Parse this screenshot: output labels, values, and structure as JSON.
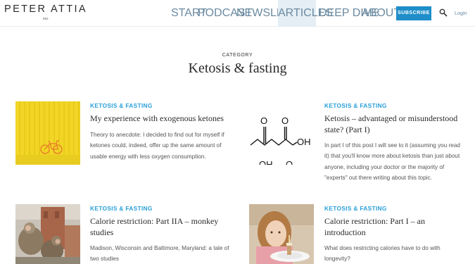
{
  "header": {
    "logo": "PETER ATTIA",
    "logo_sub": "MD",
    "nav": [
      {
        "label": "START",
        "caret": false
      },
      {
        "label": "PODCAST",
        "caret": true
      },
      {
        "label": "NEWSLETTER",
        "caret": true
      },
      {
        "label": "ARTICLES",
        "caret": true,
        "active": true
      },
      {
        "label": "DEEP DIVE",
        "caret": true
      },
      {
        "label": "ABOUT",
        "caret": true
      }
    ],
    "subscribe_label": "SUBSCRIBE",
    "search_icon": "search-icon",
    "login_label": "Login"
  },
  "category": {
    "label": "CATEGORY",
    "title": "Ketosis & fasting"
  },
  "articles": [
    {
      "tag": "KETOSIS & FASTING",
      "title": "My experience with exogenous ketones",
      "excerpt": "Theory to anecdote: I decided to find out for myself if ketones could, indeed, offer up the same amount of usable energy with less oxygen consumption.",
      "image": "yellow wall with bicycle"
    },
    {
      "tag": "KETOSIS & FASTING",
      "title": "Ketosis – advantaged or misunderstood state? (Part I)",
      "excerpt": "In part I of this post I will see to it (assuming you read it) that you'll know more about ketosis than just about anyone, including your doctor or the majority of \"experts\" out there writing about this topic.",
      "image": "acetoacetic acid structure",
      "image_text": [
        "O",
        "O",
        "OH",
        "OH",
        "O"
      ]
    },
    {
      "tag": "KETOSIS & FASTING",
      "title": "Calorie restriction: Part IIA – monkey studies",
      "excerpt": "Madison, Wisconsin and Baltimore, Maryland: a tale of two studies",
      "image": "monkeys"
    },
    {
      "tag": "KETOSIS & FASTING",
      "title": "Calorie restriction: Part I – an introduction",
      "excerpt": "What does restricting calories have to do with longevity?",
      "image": "child with small plate"
    }
  ]
}
